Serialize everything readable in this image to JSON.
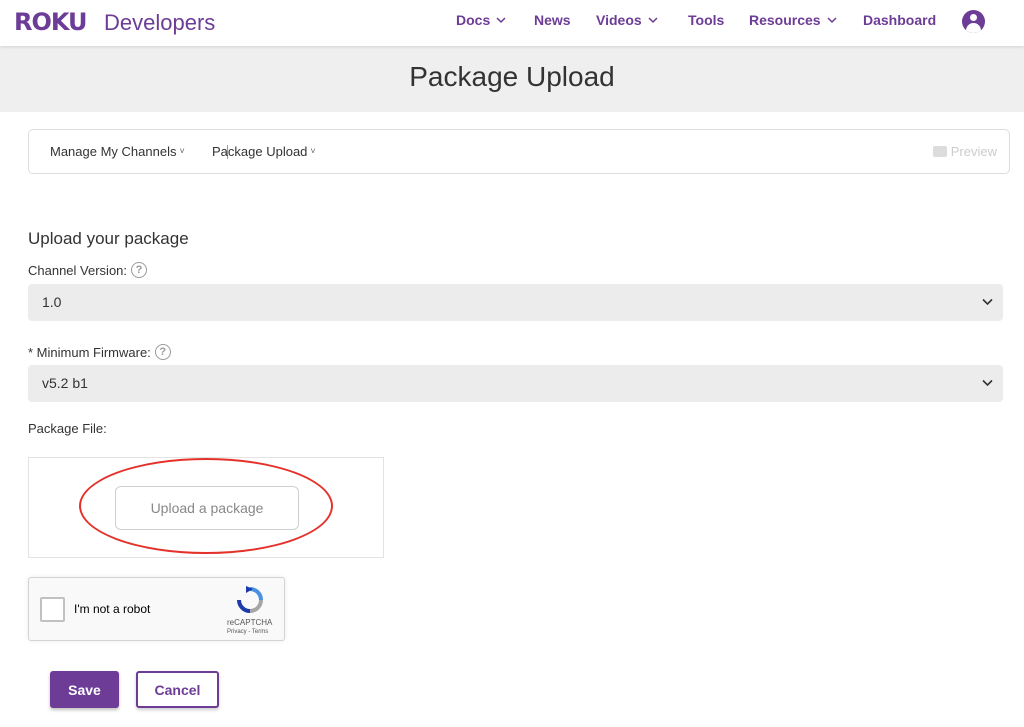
{
  "header": {
    "logo_text": "ROKU",
    "logo_sub": "Developers",
    "nav": [
      {
        "label": "Docs",
        "has_dropdown": true
      },
      {
        "label": "News",
        "has_dropdown": false
      },
      {
        "label": "Videos",
        "has_dropdown": true
      },
      {
        "label": "Tools",
        "has_dropdown": false
      },
      {
        "label": "Resources",
        "has_dropdown": true
      },
      {
        "label": "Dashboard",
        "has_dropdown": false
      }
    ],
    "account_icon": "user-circle-icon"
  },
  "page": {
    "title": "Package Upload"
  },
  "breadcrumb": {
    "items": [
      {
        "label": "Manage My Channels"
      },
      {
        "label": "Package Upload"
      }
    ],
    "caret": "˅",
    "preview_label": "Preview"
  },
  "form": {
    "heading": "Upload your package",
    "channel_version": {
      "label": "Channel Version:",
      "value": "1.0",
      "help": "?"
    },
    "min_firmware": {
      "label": "* Minimum Firmware:",
      "value": "v5.2 b1",
      "help": "?"
    },
    "package_file": {
      "label": "Package File:",
      "upload_button": "Upload a package"
    }
  },
  "captcha": {
    "label": "I'm not a robot",
    "brand": "reCAPTCHA",
    "links": "Privacy - Terms"
  },
  "actions": {
    "save": "Save",
    "cancel": "Cancel"
  },
  "colors": {
    "brand": "#6c3c97",
    "highlight": "#e4322b"
  }
}
